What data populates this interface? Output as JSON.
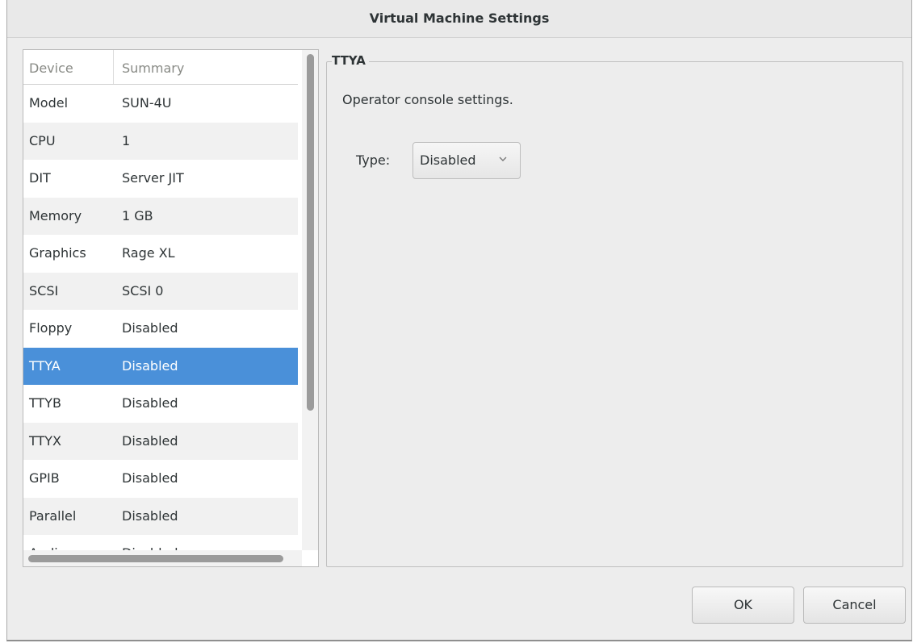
{
  "window": {
    "title": "Virtual Machine Settings"
  },
  "device_list": {
    "columns": [
      "Device",
      "Summary"
    ],
    "rows": [
      {
        "device": "Model",
        "summary": "SUN-4U"
      },
      {
        "device": "CPU",
        "summary": "1"
      },
      {
        "device": "DIT",
        "summary": "Server JIT"
      },
      {
        "device": "Memory",
        "summary": "1 GB"
      },
      {
        "device": "Graphics",
        "summary": "Rage XL"
      },
      {
        "device": "SCSI",
        "summary": "SCSI 0"
      },
      {
        "device": "Floppy",
        "summary": "Disabled"
      },
      {
        "device": "TTYA",
        "summary": "Disabled"
      },
      {
        "device": "TTYB",
        "summary": "Disabled"
      },
      {
        "device": "TTYX",
        "summary": "Disabled"
      },
      {
        "device": "GPIB",
        "summary": "Disabled"
      },
      {
        "device": "Parallel",
        "summary": "Disabled"
      },
      {
        "device": "Audio",
        "summary": "Disabled"
      }
    ],
    "selected_device": "TTYA",
    "selection_color": "#4a90d9"
  },
  "settings_panel": {
    "title": "TTYA",
    "description": "Operator console settings.",
    "type_label": "Type:",
    "type_value": "Disabled",
    "type_dropdown_icon": "chevron-down-icon"
  },
  "buttons": {
    "ok_label": "OK",
    "cancel_label": "Cancel"
  }
}
